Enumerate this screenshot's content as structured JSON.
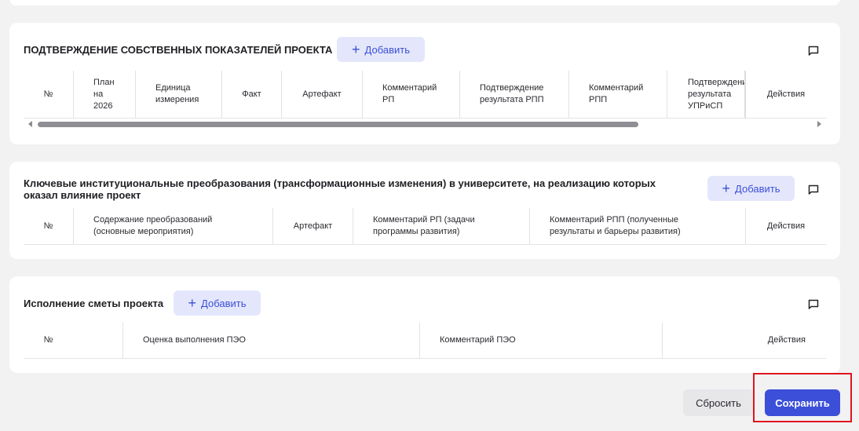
{
  "section1": {
    "title": "ПОДТВЕРЖДЕНИЕ СОБСТВЕННЫХ ПОКАЗАТЕЛЕЙ ПРОЕКТА",
    "add_label": "Добавить",
    "columns": [
      "№",
      "План на 2026",
      "Единица измерения",
      "Факт",
      "Артефакт",
      "Комментарий РП",
      "Подтверждение результата РПП",
      "Комментарий РПП",
      "Подтверждение результата УПРиСП",
      "Действия"
    ]
  },
  "section2": {
    "title": "Ключевые институциональные преобразования (трансформационные изменения) в университете, на реализацию которых оказал влияние проект",
    "add_label": "Добавить",
    "columns": [
      "№",
      "Содержание преобразований (основные мероприятия)",
      "Артефакт",
      "Комментарий РП (задачи программы развития)",
      "Комментарий РПП (полученные результаты и барьеры развития)",
      "Действия"
    ]
  },
  "section3": {
    "title": "Исполнение сметы проекта",
    "add_label": "Добавить",
    "columns": [
      "№",
      "Оценка выполнения ПЭО",
      "Комментарий ПЭО",
      "Действия"
    ]
  },
  "footer": {
    "reset_label": "Сбросить",
    "save_label": "Сохранить"
  },
  "icons": {
    "add": "plus-icon",
    "comment": "comment-icon",
    "scroll_left": "scroll-left-icon",
    "scroll_right": "scroll-right-icon"
  },
  "colors": {
    "accent": "#3b4fd8",
    "accent_light": "#e4e7fb",
    "highlight": "#e0141d"
  }
}
